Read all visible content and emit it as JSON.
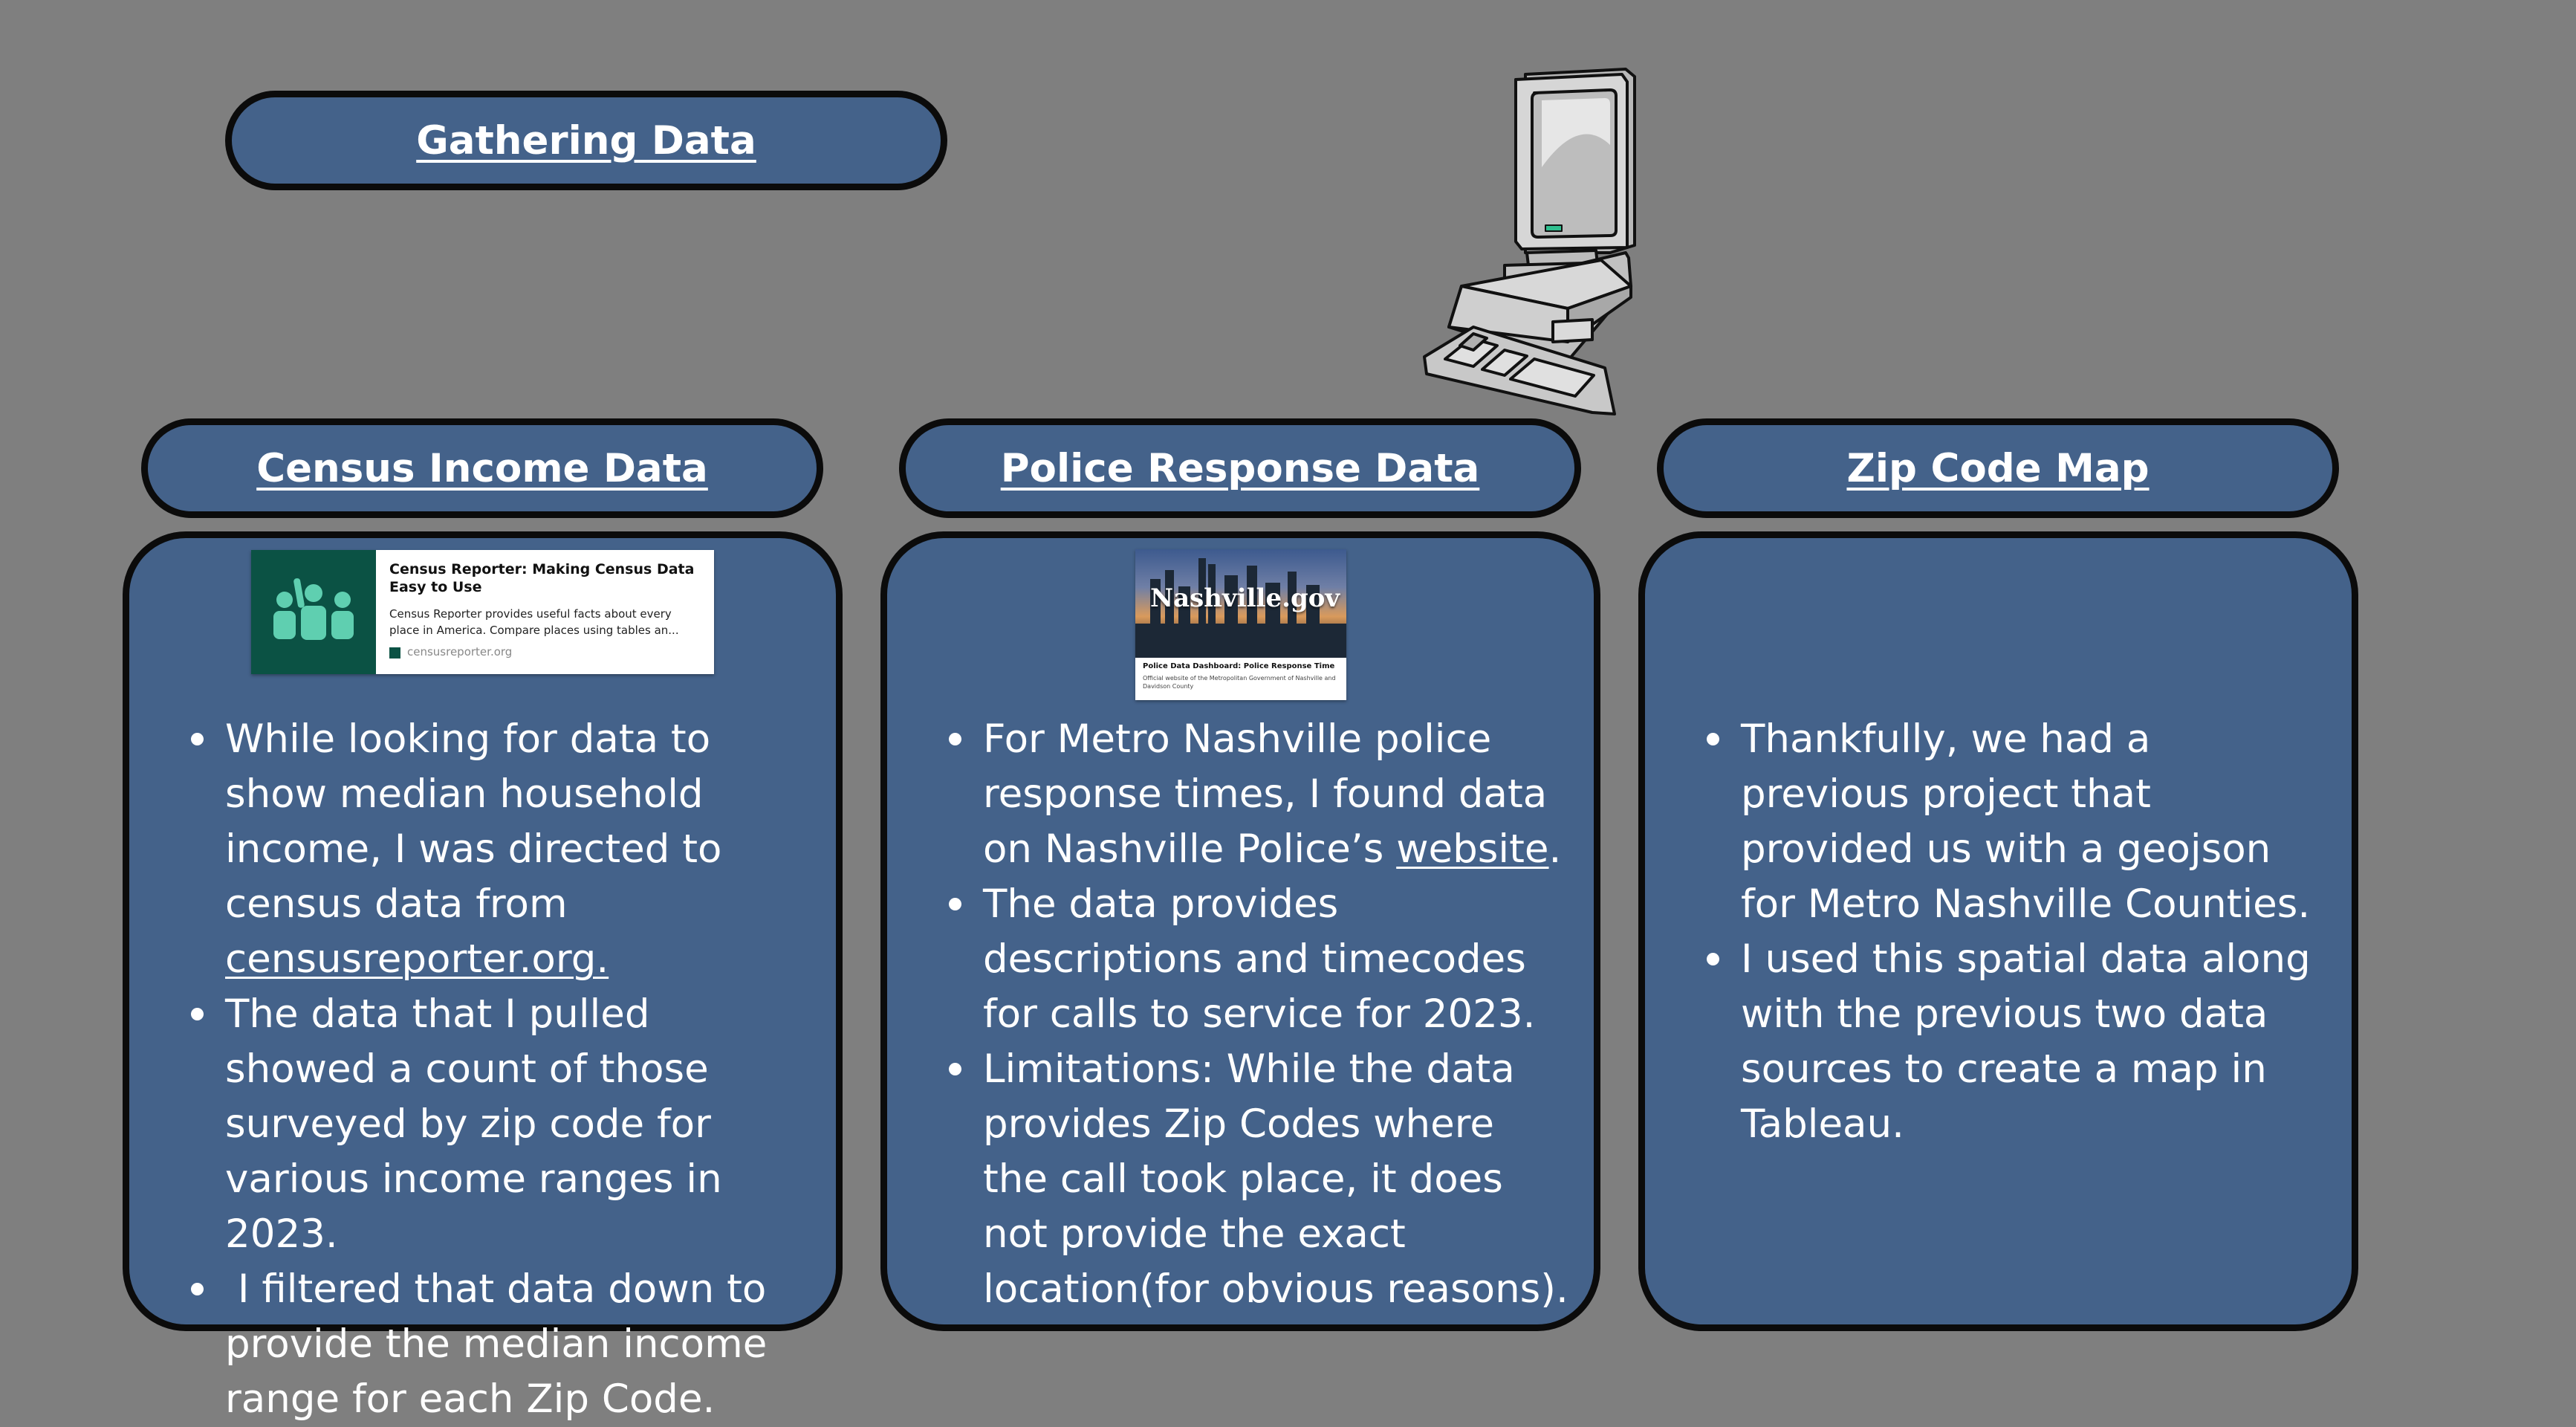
{
  "header": {
    "title": "Gathering Data"
  },
  "columns": [
    {
      "heading": "Census Income Data",
      "card": {
        "title": "Census Reporter: Making Census Data Easy to Use",
        "description": "Census Reporter provides useful facts about every place in America. Compare places using tables an...",
        "site": "censusreporter.org"
      },
      "bullets": [
        "While looking for data to show median household income, I was directed to census data from ",
        "The data that I pulled showed a count of those surveyed by zip code for various income ranges in 2023.",
        " I filtered that data down to provide the median income range for each Zip Code."
      ],
      "link_text": "censusreporter.org."
    },
    {
      "heading": "Police Response Data",
      "card": {
        "logo": "Nashville.gov",
        "caption_title": "Police Data Dashboard: Police Response Time",
        "caption_desc": "Official website of the Metropolitan Government of Nashville and Davidson County"
      },
      "bullets": [
        "For Metro Nashville police response times, I found data on Nashville Police’s ",
        "The data provides descriptions and timecodes for calls to service for 2023.",
        "Limitations: While the data provides Zip Codes where the call took place, it does not provide the exact location(for obvious reasons)."
      ],
      "link_text": "website",
      "link_suffix": "."
    },
    {
      "heading": "Zip Code Map",
      "bullets": [
        "Thankfully, we had a previous project that provided us with a geojson for Metro Nashville Counties.",
        "I used this spatial data along with the previous two data sources to create a map in Tableau."
      ]
    }
  ],
  "colors": {
    "background": "#7f7f7f",
    "panel": "#44628a",
    "border": "#0b0b0b"
  },
  "icons": [
    "computer-icon",
    "census-people-icon"
  ]
}
